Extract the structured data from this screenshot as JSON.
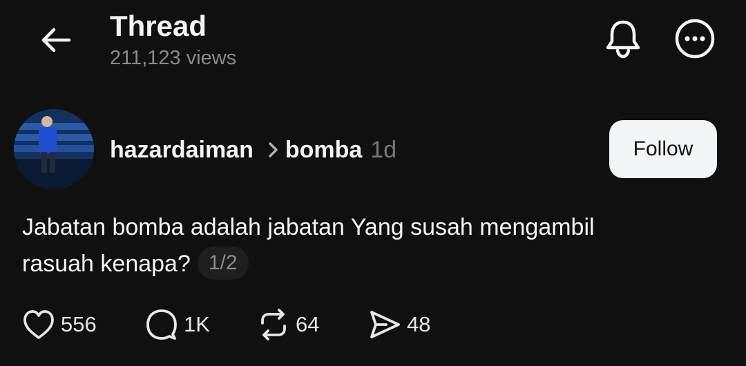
{
  "header": {
    "title": "Thread",
    "views": "211,123 views",
    "back_icon": "arrow-left-icon",
    "notify_icon": "bell-icon",
    "more_icon": "more-horizontal-icon"
  },
  "post": {
    "username": "hazardaiman",
    "community": "bomba",
    "age": "1d",
    "follow_label": "Follow",
    "text_line1": "Jabatan bomba adalah jabatan Yang susah mengambil",
    "text_line2": "rasuah kenapa?",
    "page_indicator": "1/2"
  },
  "actions": {
    "likes": "556",
    "replies": "1K",
    "reposts": "64",
    "shares": "48"
  },
  "colors": {
    "background": "#101010",
    "primary_text": "#f3f5f7",
    "secondary_text": "#8a8a8a",
    "button_bg": "#f3f5f7"
  }
}
